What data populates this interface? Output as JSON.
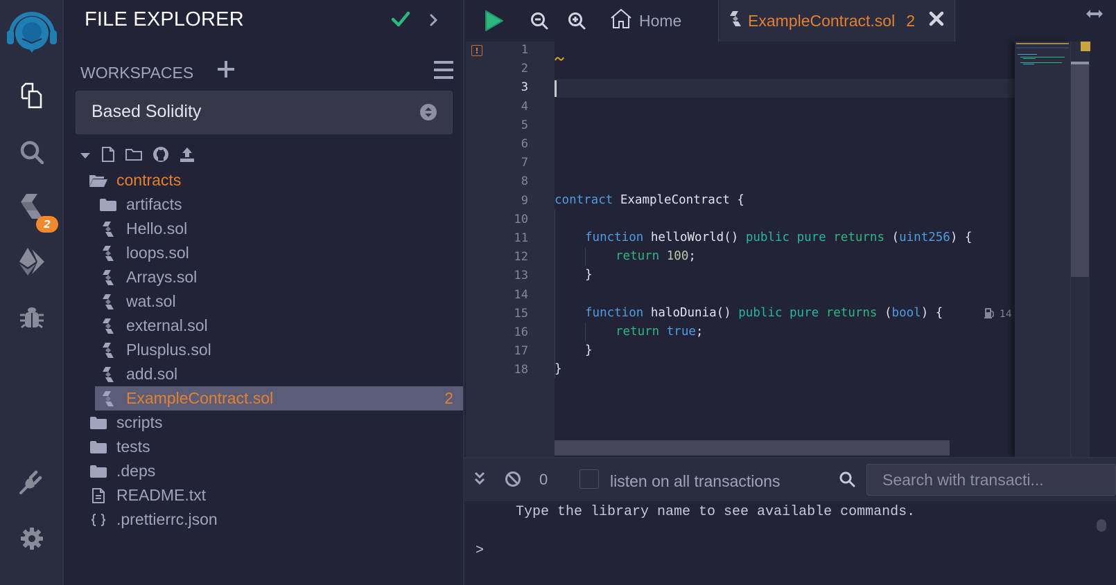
{
  "rail": {
    "badge_count": "2",
    "items": [
      "file-explorer",
      "search",
      "solidity-compiler",
      "deploy-run",
      "debugger",
      "plugin-manager",
      "settings"
    ]
  },
  "explorer": {
    "title": "FILE EXPLORER",
    "workspaces_label": "WORKSPACES",
    "workspace_selected": "Based Solidity",
    "tree": [
      {
        "name": "contracts",
        "type": "folder-open",
        "level": 0,
        "highlight": true
      },
      {
        "name": "artifacts",
        "type": "folder",
        "level": 1
      },
      {
        "name": "Hello.sol",
        "type": "sol",
        "level": 1
      },
      {
        "name": "loops.sol",
        "type": "sol",
        "level": 1
      },
      {
        "name": "Arrays.sol",
        "type": "sol",
        "level": 1
      },
      {
        "name": "wat.sol",
        "type": "sol",
        "level": 1
      },
      {
        "name": "external.sol",
        "type": "sol",
        "level": 1
      },
      {
        "name": "Plusplus.sol",
        "type": "sol",
        "level": 1
      },
      {
        "name": "add.sol",
        "type": "sol",
        "level": 1
      },
      {
        "name": "ExampleContract.sol",
        "type": "sol",
        "level": 1,
        "active": true,
        "count": "2"
      },
      {
        "name": "scripts",
        "type": "folder",
        "level": 0
      },
      {
        "name": "tests",
        "type": "folder",
        "level": 0
      },
      {
        "name": ".deps",
        "type": "folder",
        "level": 0
      },
      {
        "name": "README.txt",
        "type": "file",
        "level": 0
      },
      {
        "name": ".prettierrc.json",
        "type": "json",
        "level": 0
      }
    ]
  },
  "editor": {
    "home_tab": "Home",
    "file_tab": "ExampleContract.sol",
    "file_tab_count": "2",
    "line_numbers": [
      "1",
      "2",
      "3",
      "4",
      "5",
      "6",
      "7",
      "8",
      "9",
      "10",
      "11",
      "12",
      "13",
      "14",
      "15",
      "16",
      "17",
      "18"
    ],
    "current_line": 3,
    "code": {
      "l9": {
        "kw": "contract",
        "rest": " ExampleContract {"
      },
      "l11": {
        "fn": "function",
        "name": " helloWorld() ",
        "vis": "public",
        "mut": " pure",
        "ret": " returns",
        "open": " (",
        "type": "uint256",
        "close": ") {"
      },
      "l12": {
        "ret": "return",
        "val": " 100",
        "end": ";"
      },
      "l13": "}",
      "l15": {
        "fn": "function",
        "name": " haloDunia() ",
        "vis": "public",
        "mut": " pure",
        "ret": " returns",
        "open": " (",
        "type": "bool",
        "close": ") {"
      },
      "l16": {
        "ret": "return",
        "val": " true",
        "end": ";"
      },
      "l17": "}",
      "l18": "}"
    },
    "gas_estimate": "14"
  },
  "terminal": {
    "tx_count": "0",
    "listen_label": "listen on all transactions",
    "listen_checked": false,
    "search_placeholder": "Search with transacti...",
    "message": "Type the library name to see available commands.",
    "prompt": ">"
  },
  "colors": {
    "accent_orange": "#e4812f",
    "success_green": "#2ab87e",
    "keyword_blue": "#4d9ee0",
    "background": "#222336"
  }
}
